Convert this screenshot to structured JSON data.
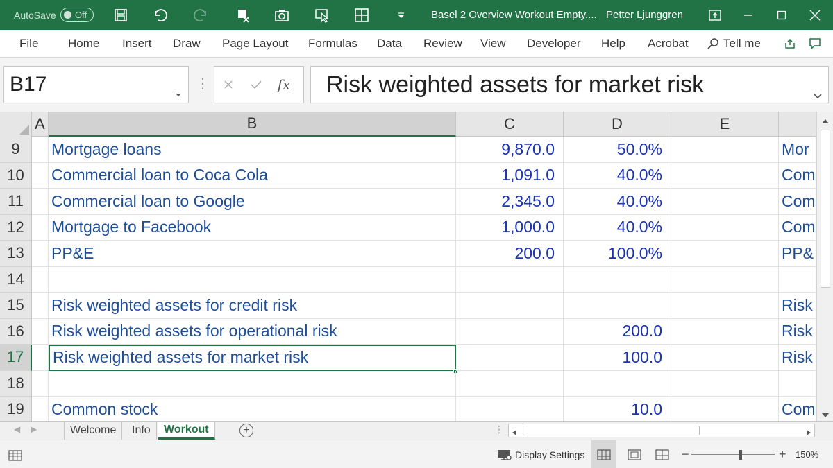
{
  "titlebar": {
    "autosave_label": "AutoSave",
    "autosave_state": "Off",
    "doc_title": "Basel 2 Overview Workout Empty....",
    "user": "Petter Ljunggren"
  },
  "ribbon": {
    "tabs": [
      "File",
      "Home",
      "Insert",
      "Draw",
      "Page Layout",
      "Formulas",
      "Data",
      "Review",
      "View",
      "Developer",
      "Help",
      "Acrobat"
    ],
    "tell_me": "Tell me"
  },
  "formula_bar": {
    "name_box": "B17",
    "fx": "fx",
    "formula": "Risk weighted assets for market risk"
  },
  "columns": [
    "A",
    "B",
    "C",
    "D",
    "E"
  ],
  "rows": [
    {
      "num": "9",
      "b": "Mortgage loans",
      "c": "9,870.0",
      "d": "50.0%",
      "f": "Mor"
    },
    {
      "num": "10",
      "b": "Commercial loan to Coca Cola",
      "c": "1,091.0",
      "d": "40.0%",
      "f": "Com"
    },
    {
      "num": "11",
      "b": "Commercial loan to Google",
      "c": "2,345.0",
      "d": "40.0%",
      "f": "Com"
    },
    {
      "num": "12",
      "b": "Mortgage to Facebook",
      "c": "1,000.0",
      "d": "40.0%",
      "f": "Com"
    },
    {
      "num": "13",
      "b": "PP&E",
      "c": "200.0",
      "d": "100.0%",
      "f": "PP&"
    },
    {
      "num": "14",
      "b": "",
      "c": "",
      "d": "",
      "f": ""
    },
    {
      "num": "15",
      "b": "Risk weighted assets for credit risk",
      "c": "",
      "d": "",
      "f": "Risk"
    },
    {
      "num": "16",
      "b": "Risk weighted assets for operational risk",
      "c": "",
      "d": "200.0",
      "f": "Risk"
    },
    {
      "num": "17",
      "b": "Risk weighted assets for market risk",
      "c": "",
      "d": "100.0",
      "f": "Risk"
    },
    {
      "num": "18",
      "b": "",
      "c": "",
      "d": "",
      "f": ""
    },
    {
      "num": "19",
      "b": "Common stock",
      "c": "",
      "d": "10.0",
      "f": "Com"
    }
  ],
  "selected_row": "17",
  "sheets": [
    "Welcome",
    "Info",
    "Workout"
  ],
  "active_sheet": "Workout",
  "status": {
    "display_settings": "Display Settings",
    "zoom": "150%"
  },
  "colors": {
    "accent": "#217346",
    "cell_text": "#1f4e99"
  }
}
